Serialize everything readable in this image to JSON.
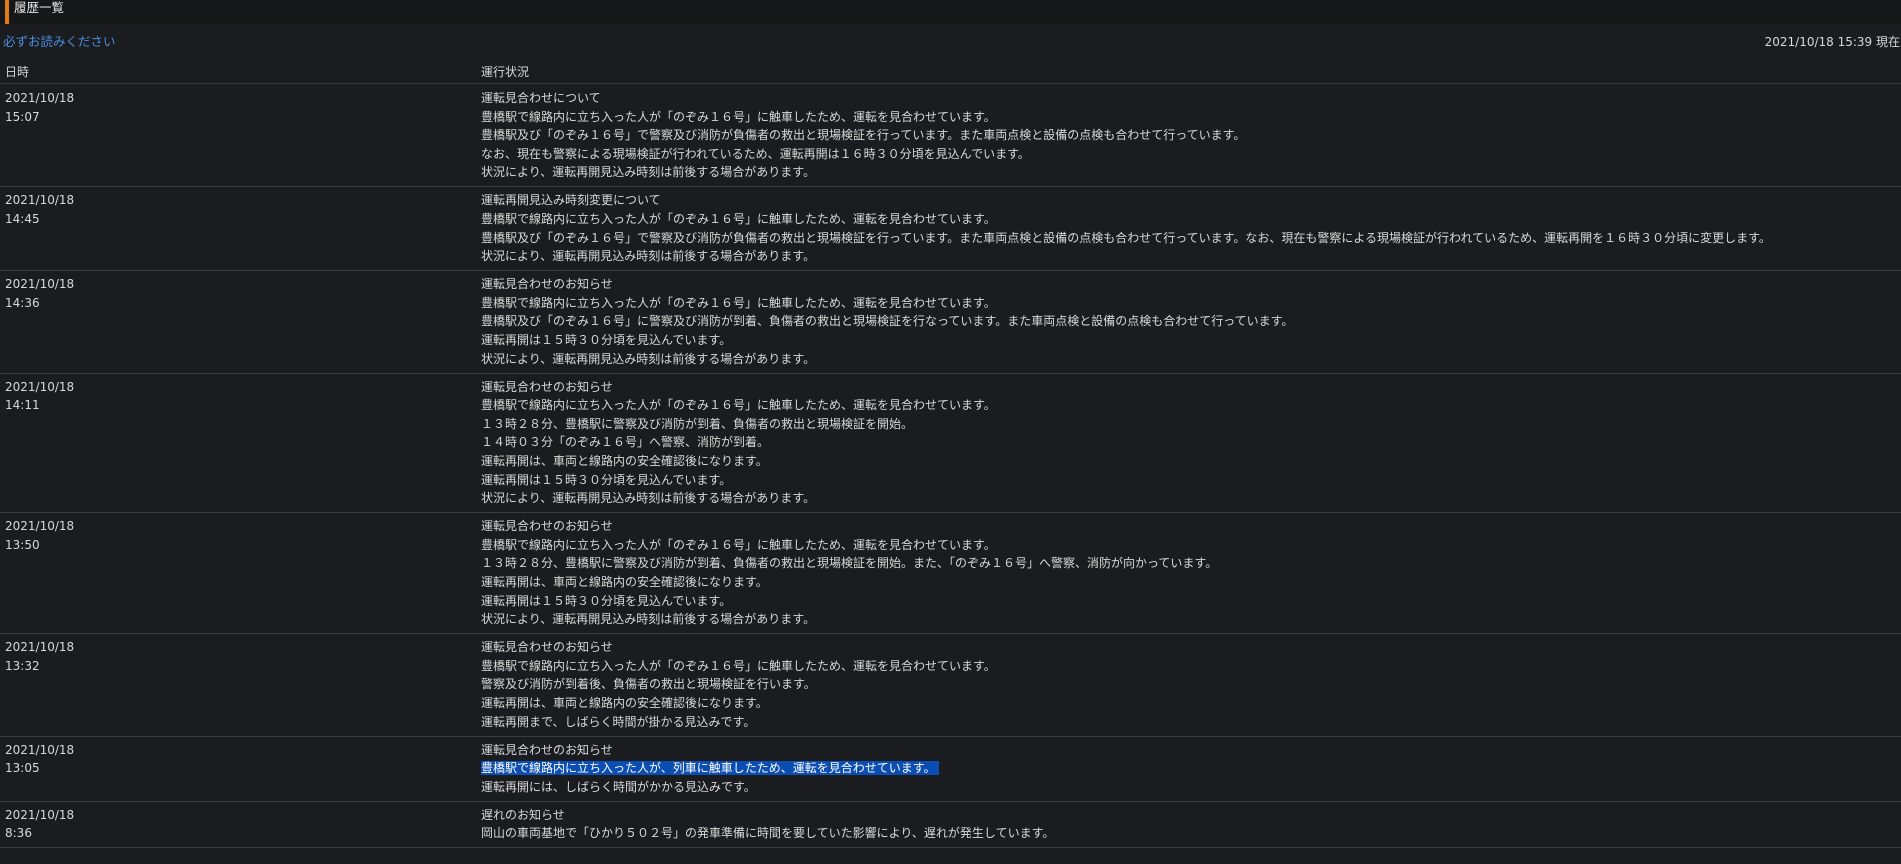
{
  "header": {
    "title": "履歴一覧",
    "notice_link": "必ずお読みください",
    "as_of": "2021/10/18 15:39 現在"
  },
  "columns": {
    "datetime": "日時",
    "status": "運行状況"
  },
  "colors": {
    "background": "#1b1c1f",
    "accent": "#e07a16",
    "link": "#4a8fe0",
    "selection": "#0b4eb3"
  },
  "entries": [
    {
      "date": "2021/10/18",
      "time": "15:07",
      "lines": [
        "運転見合わせについて",
        "豊橋駅で線路内に立ち入った人が「のぞみ１６号」に触車したため、運転を見合わせています。",
        "豊橋駅及び「のぞみ１６号」で警察及び消防が負傷者の救出と現場検証を行っています。また車両点検と設備の点検も合わせて行っています。",
        "なお、現在も警察による現場検証が行われているため、運転再開は１６時３０分頃を見込んでいます。",
        "状況により、運転再開見込み時刻は前後する場合があります。"
      ]
    },
    {
      "date": "2021/10/18",
      "time": "14:45",
      "lines": [
        "運転再開見込み時刻変更について",
        "豊橋駅で線路内に立ち入った人が「のぞみ１６号」に触車したため、運転を見合わせています。",
        "豊橋駅及び「のぞみ１６号」で警察及び消防が負傷者の救出と現場検証を行っています。また車両点検と設備の点検も合わせて行っています。なお、現在も警察による現場検証が行われているため、運転再開を１６時３０分頃に変更します。",
        "状況により、運転再開見込み時刻は前後する場合があります。"
      ]
    },
    {
      "date": "2021/10/18",
      "time": "14:36",
      "lines": [
        "運転見合わせのお知らせ",
        "豊橋駅で線路内に立ち入った人が「のぞみ１６号」に触車したため、運転を見合わせています。",
        "豊橋駅及び「のぞみ１６号」に警察及び消防が到着、負傷者の救出と現場検証を行なっています。また車両点検と設備の点検も合わせて行っています。",
        "運転再開は１５時３０分頃を見込んでいます。",
        "状況により、運転再開見込み時刻は前後する場合があります。"
      ]
    },
    {
      "date": "2021/10/18",
      "time": "14:11",
      "lines": [
        "運転見合わせのお知らせ",
        "豊橋駅で線路内に立ち入った人が「のぞみ１６号」に触車したため、運転を見合わせています。",
        "１３時２８分、豊橋駅に警察及び消防が到着、負傷者の救出と現場検証を開始。",
        "１４時０３分「のぞみ１６号」へ警察、消防が到着。",
        "運転再開は、車両と線路内の安全確認後になります。",
        "運転再開は１５時３０分頃を見込んでいます。",
        "状況により、運転再開見込み時刻は前後する場合があります。"
      ]
    },
    {
      "date": "2021/10/18",
      "time": "13:50",
      "lines": [
        "運転見合わせのお知らせ",
        "豊橋駅で線路内に立ち入った人が「のぞみ１６号」に触車したため、運転を見合わせています。",
        "１３時２８分、豊橋駅に警察及び消防が到着、負傷者の救出と現場検証を開始。また、「のぞみ１６号」へ警察、消防が向かっています。",
        "運転再開は、車両と線路内の安全確認後になります。",
        "運転再開は１５時３０分頃を見込んでいます。",
        "状況により、運転再開見込み時刻は前後する場合があります。"
      ]
    },
    {
      "date": "2021/10/18",
      "time": "13:32",
      "lines": [
        "運転見合わせのお知らせ",
        "豊橋駅で線路内に立ち入った人が「のぞみ１６号」に触車したため、運転を見合わせています。",
        "警察及び消防が到着後、負傷者の救出と現場検証を行います。",
        "運転再開は、車両と線路内の安全確認後になります。",
        "運転再開まで、しばらく時間が掛かる見込みです。"
      ]
    },
    {
      "date": "2021/10/18",
      "time": "13:05",
      "selected_line": 1,
      "lines": [
        "運転見合わせのお知らせ",
        "豊橋駅で線路内に立ち入った人が、列車に触車したため、運転を見合わせています。",
        "運転再開には、しばらく時間がかかる見込みです。"
      ]
    },
    {
      "date": "2021/10/18",
      "time": "8:36",
      "lines": [
        "遅れのお知らせ",
        "岡山の車両基地で「ひかり５０２号」の発車準備に時間を要していた影響により、遅れが発生しています。"
      ]
    }
  ]
}
